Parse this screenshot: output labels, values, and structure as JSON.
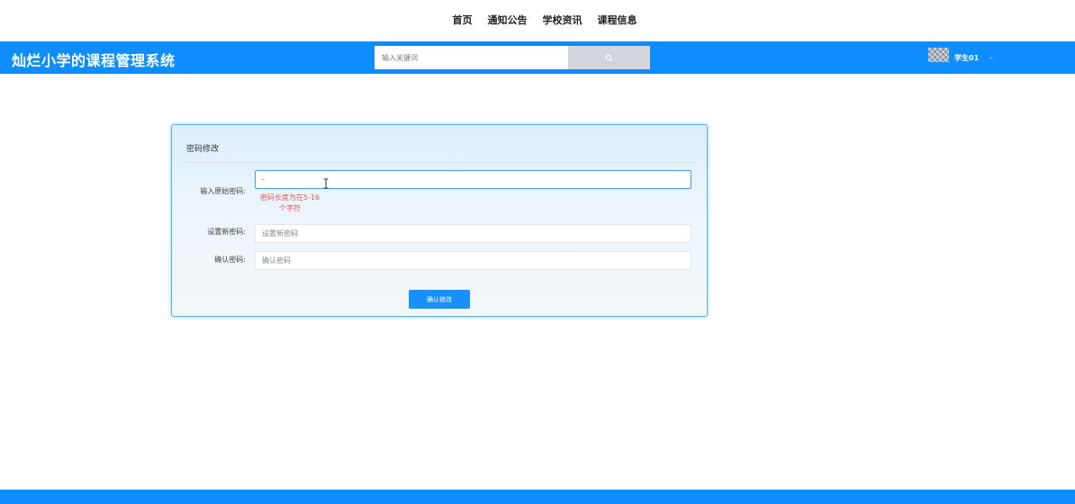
{
  "nav": {
    "items": [
      {
        "label": "首页"
      },
      {
        "label": "通知公告"
      },
      {
        "label": "学校资讯"
      },
      {
        "label": "课程信息"
      }
    ]
  },
  "header": {
    "title": "灿烂小学的课程管理系统",
    "search": {
      "placeholder": "输入关键词",
      "icon": "search-icon"
    },
    "user": {
      "name": "学生01",
      "caret": "-"
    },
    "color": "#0d8dff"
  },
  "form": {
    "title": "密码修改",
    "old_password": {
      "label": "输入原始密码:",
      "value": "-",
      "error": "密码长度为在5-16个字符"
    },
    "new_password": {
      "label": "设置新密码:",
      "placeholder": "设置新密码"
    },
    "confirm_password": {
      "label": "确认密码:",
      "placeholder": "确认密码"
    },
    "submit_label": "确认修改",
    "accent": "#1890ff",
    "error_color": "#e55a5a"
  }
}
